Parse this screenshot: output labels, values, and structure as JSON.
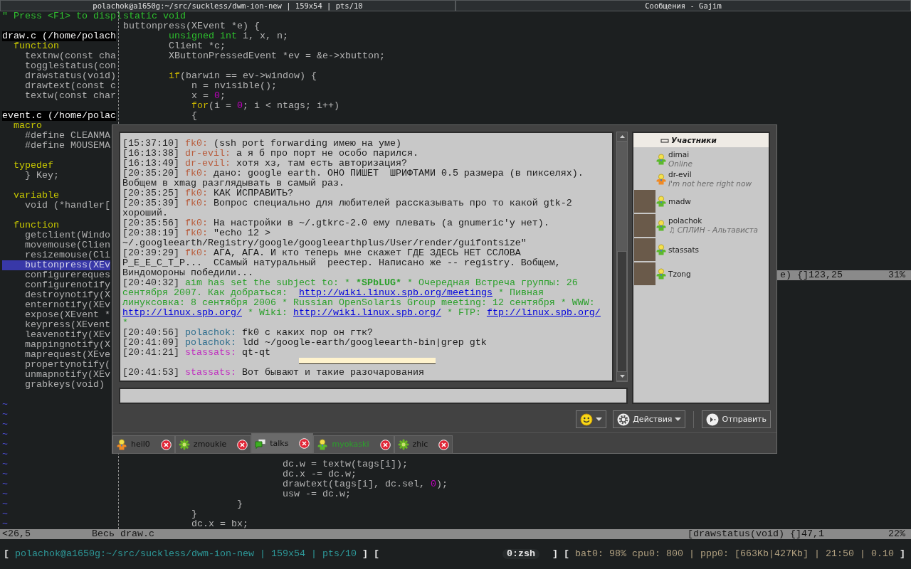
{
  "frame_tabs": [
    {
      "title": "polachok@a1650g:~/src/suckless/dwm-ion-new | 159x54 | pts/10"
    },
    {
      "title": "Сообщения - Gajim"
    }
  ],
  "taglist": {
    "help": "\" Press <F1> to displ",
    "files": [
      {
        "name": "draw.c (/home/polach",
        "sections": [
          {
            "name": "function",
            "items": [
              {
                "text": "textnw(const cha",
                "selected": false
              },
              {
                "text": "togglestatus(con",
                "selected": false
              },
              {
                "text": "drawstatus(void)",
                "selected": false
              },
              {
                "text": "drawtext(const c",
                "selected": false
              },
              {
                "text": "textw(const char",
                "selected": false
              }
            ]
          }
        ]
      },
      {
        "name": "event.c (/home/polac",
        "sections": [
          {
            "name": "macro",
            "items": [
              {
                "text": "#define CLEANMA",
                "selected": false
              },
              {
                "text": "#define MOUSEMA",
                "selected": false
              }
            ]
          },
          {
            "name": "typedef",
            "items": [
              {
                "text": "} Key;",
                "selected": false
              }
            ]
          },
          {
            "name": "variable",
            "items": [
              {
                "text": "void (*handler[",
                "selected": false
              }
            ]
          },
          {
            "name": "function",
            "items": [
              {
                "text": "getclient(Windo",
                "selected": false
              },
              {
                "text": "movemouse(Clien",
                "selected": false
              },
              {
                "text": "resizemouse(Cli",
                "selected": false
              },
              {
                "text": "buttonpress(XEv",
                "selected": true
              },
              {
                "text": "configurereques",
                "selected": false
              },
              {
                "text": "configurenotify",
                "selected": false
              },
              {
                "text": "destroynotify(X",
                "selected": false
              },
              {
                "text": "enternotify(XEv",
                "selected": false
              },
              {
                "text": "expose(XEvent *",
                "selected": false
              },
              {
                "text": "keypress(XEvent",
                "selected": false
              },
              {
                "text": "leavenotify(XEv",
                "selected": false
              },
              {
                "text": "mappingnotify(X",
                "selected": false
              },
              {
                "text": "maprequest(XEve",
                "selected": false
              },
              {
                "text": "propertynotify(",
                "selected": false
              },
              {
                "text": "unmapnotify(XEv",
                "selected": false
              },
              {
                "text": "grabkeys(void)",
                "selected": false
              }
            ]
          }
        ]
      }
    ],
    "end_markers": [
      "~",
      "~",
      "~",
      "~",
      "~",
      "~",
      "~",
      "~",
      "~",
      "~",
      "~",
      "~",
      "~"
    ]
  },
  "code": {
    "top_blocks": [
      [
        [
          {
            "text": "static void",
            "kind": "type"
          }
        ],
        [
          {
            "text": "buttonpress(XEvent *e) {",
            "kind": "plain"
          }
        ],
        [
          {
            "text": "        unsigned int",
            "kind": "type"
          },
          {
            "text": " i, x, n;",
            "kind": "plain"
          }
        ],
        [
          {
            "text": "        Client *c;",
            "kind": "plain"
          }
        ],
        [
          {
            "text": "        XButtonPressedEvent *ev = &e->xbutton;",
            "kind": "plain"
          }
        ]
      ],
      [
        [
          {
            "text": "        if",
            "kind": "keyword"
          },
          {
            "text": "(barwin == ev->window) {",
            "kind": "plain"
          }
        ],
        [
          {
            "text": "            n = nvisible();",
            "kind": "plain"
          }
        ],
        [
          {
            "text": "            x = ",
            "kind": "plain"
          },
          {
            "text": "0",
            "kind": "number"
          },
          {
            "text": ";",
            "kind": "plain"
          }
        ],
        [
          {
            "text": "            for",
            "kind": "keyword"
          },
          {
            "text": "(i = ",
            "kind": "plain"
          },
          {
            "text": "0",
            "kind": "number"
          },
          {
            "text": "; i < ntags; i++)",
            "kind": "plain"
          }
        ],
        [
          {
            "text": "            {",
            "kind": "plain"
          }
        ]
      ]
    ],
    "top_status": {
      "location": "e) {]123,25",
      "percent": "31%"
    },
    "bottom_blocks": [
      [
        [
          {
            "text": "                            dc.w = textw(tags[i]);",
            "kind": "plain"
          }
        ],
        [
          {
            "text": "                            dc.x -= dc.w;",
            "kind": "plain"
          }
        ],
        [
          {
            "text": "                            drawtext(tags[i], dc.sel, ",
            "kind": "plain"
          },
          {
            "text": "0",
            "kind": "number"
          },
          {
            "text": ");",
            "kind": "plain"
          }
        ],
        [
          {
            "text": "                            usw -= dc.w;",
            "kind": "plain"
          }
        ],
        [
          {
            "text": "                    }",
            "kind": "plain"
          }
        ],
        [
          {
            "text": "            }",
            "kind": "plain"
          }
        ],
        [
          {
            "text": "            dc.x = bx;",
            "kind": "plain"
          }
        ]
      ]
    ]
  },
  "vim_status": {
    "position": "<26,5",
    "file": "Весь draw.c",
    "location": "[drawstatus(void) {]47,1",
    "percent": "22%"
  },
  "bottom_bar": {
    "left": [
      {
        "text": "[",
        "kind": "bracket"
      },
      {
        "text": "polachok@a1650g:~/src/suckless/dwm-ion-new | 159x54 | pts/10",
        "kind": "title"
      },
      {
        "text": "] [",
        "kind": "bracket"
      }
    ],
    "right": [
      {
        "text": "0:zsh",
        "kind": "workspace"
      },
      {
        "text": "] [",
        "kind": "bracket"
      },
      {
        "text": "bat0: 98% cpu0: 800 | ppp0: [663Kb|427Kb] | 21:50 | 0.10",
        "kind": "info"
      },
      {
        "text": "]",
        "kind": "bracket"
      }
    ]
  },
  "chat": {
    "messages": [
      {
        "kind": "message",
        "time": "[15:37:10]",
        "nick": "fk0:",
        "color": "#b85c3c",
        "text": "(ssh port forwarding имею на уме)"
      },
      {
        "kind": "message",
        "time": "[16:13:38]",
        "nick": "dr-evil:",
        "color": "#b85c3c",
        "text": "а я б про порт не особо парился."
      },
      {
        "kind": "message",
        "time": "[16:13:49]",
        "nick": "dr-evil:",
        "color": "#b85c3c",
        "text": "хотя хз, там есть авторизация?"
      },
      {
        "kind": "message",
        "time": "[20:35:20]",
        "nick": "fk0:",
        "color": "#b85c3c",
        "text": "дано: google earth. ОНО ПИШЕТ  ШРИФТАМИ 0.5 размера (в пикселях). Вобщем в xmag разглядывать в самый раз."
      },
      {
        "kind": "message",
        "time": "[20:35:25]",
        "nick": "fk0:",
        "color": "#b85c3c",
        "text": "КАК ИСПРАВИТЬ?"
      },
      {
        "kind": "message",
        "time": "[20:35:39]",
        "nick": "fk0:",
        "color": "#b85c3c",
        "text": "Вопрос специально для любителей рассказывать про то какой gtk-2 хороший."
      },
      {
        "kind": "message",
        "time": "[20:35:56]",
        "nick": "fk0:",
        "color": "#b85c3c",
        "text": "На настройки в ~/.gtkrc-2.0 ему плевать (а gnumeric'у нет)."
      },
      {
        "kind": "message",
        "time": "[20:38:19]",
        "nick": "fk0:",
        "color": "#b85c3c",
        "text": "\"echo 12 > ~/.googleearth/Registry/google/googleearthplus/User/render/guifontsize\""
      },
      {
        "kind": "message",
        "time": "[20:39:29]",
        "nick": "fk0:",
        "color": "#b85c3c",
        "text": "АГА, АГА. И кто теперь мне скажет ГДЕ ЗДЕСЬ НЕТ ССЛОВА P_E_E_C_T_P...  ССамый натуральный  реестер. Написано же -- registry. Вобщем, Виндомороны победили..."
      },
      {
        "kind": "subject",
        "time": "[20:40:32]",
        "color": "#2ca02c",
        "segments": [
          {
            "text": "aim has set the subject to: * ",
            "kind": "text"
          },
          {
            "text": "*SPbLUG*",
            "kind": "bold"
          },
          {
            "text": " * Очередная Встреча группы: 26 сентября 2007. Как добраться:  ",
            "kind": "text"
          },
          {
            "text": "http://wiki.linux.spb.org/meetings",
            "kind": "link"
          },
          {
            "text": " * Пивная линуксовка: 8 сентября 2006 * Russian OpenSolaris Group meeting: 12 сентября * WWW: ",
            "kind": "text"
          },
          {
            "text": "http://linux.spb.org/",
            "kind": "link"
          },
          {
            "text": " * Wiki: ",
            "kind": "text"
          },
          {
            "text": "http://wiki.linux.spb.org/",
            "kind": "link"
          },
          {
            "text": " * FTP: ",
            "kind": "text"
          },
          {
            "text": "ftp://linux.spb.org/",
            "kind": "link"
          },
          {
            "text": " *",
            "kind": "text"
          }
        ]
      },
      {
        "kind": "message",
        "time": "[20:40:56]",
        "nick": "polachok:",
        "color": "#2e6e8e",
        "text": "fk0 с каких пор он гтк?"
      },
      {
        "kind": "message",
        "time": "[20:41:09]",
        "nick": "polachok:",
        "color": "#2e6e8e",
        "text": "ldd ~/google-earth/googleearth-bin|grep gtk"
      },
      {
        "kind": "message",
        "time": "[20:41:21]",
        "nick": "stassats:",
        "color": "#c030c0",
        "text": "qt-qt"
      },
      {
        "kind": "marker"
      },
      {
        "kind": "message",
        "time": "[20:41:53]",
        "nick": "stassats:",
        "color": "#c030c0",
        "text": "Вот бывают и такие разочарования"
      }
    ],
    "roster": {
      "group": "Участники",
      "expanded": true,
      "contacts": [
        {
          "name": "dimai",
          "status_text": "Online",
          "color": "#5cb82c",
          "avatar": false
        },
        {
          "name": "dr-evil",
          "status_text": "I'm not here right now",
          "color": "#f08a24",
          "avatar": false
        },
        {
          "name": "madw",
          "color": "#5cb82c",
          "avatar": true
        },
        {
          "name": "polachok",
          "status_text": "♫ СПЛИН - Альтависта",
          "color": "#5cb82c",
          "avatar": true
        },
        {
          "name": "stassats",
          "color": "#5cb82c",
          "avatar": true
        },
        {
          "name": "Tzong",
          "color": "#5cb82c",
          "avatar": true
        }
      ]
    },
    "buttons": [
      {
        "kind": "emoticons"
      },
      {
        "kind": "actions",
        "label": "Действия"
      },
      {
        "kind": "send",
        "label": "Отправить"
      }
    ],
    "tabs": [
      {
        "label": "heil0",
        "kind": "away-contact",
        "selected": false,
        "unread": false
      },
      {
        "label": "zmoukie",
        "kind": "icq-contact",
        "selected": false,
        "unread": false
      },
      {
        "label": "talks",
        "kind": "groupchat",
        "selected": true,
        "unread": false
      },
      {
        "label": "myokaski",
        "kind": "online-contact",
        "selected": false,
        "unread": true
      },
      {
        "label": "zhic",
        "kind": "icq-contact",
        "selected": false,
        "unread": false
      }
    ]
  }
}
